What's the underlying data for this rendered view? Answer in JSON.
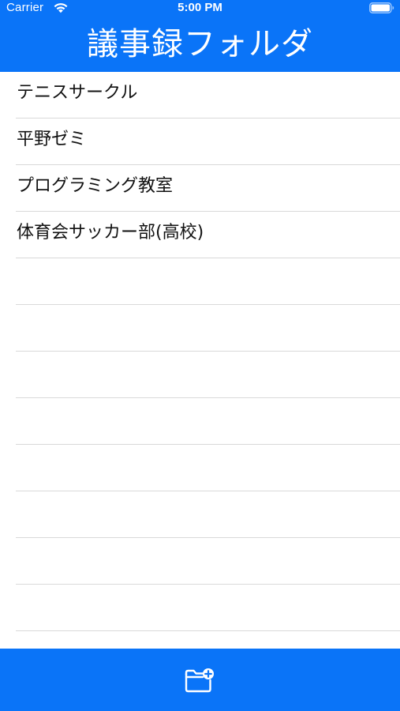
{
  "status_bar": {
    "carrier": "Carrier",
    "time": "5:00 PM",
    "icons": [
      "wifi-icon",
      "battery-icon"
    ]
  },
  "nav": {
    "title": "議事録フォルダ"
  },
  "folders": [
    {
      "label": "テニスサークル"
    },
    {
      "label": "平野ゼミ"
    },
    {
      "label": "プログラミング教室"
    },
    {
      "label": "体育会サッカー部(高校)"
    }
  ],
  "empty_row_count_visible": 8,
  "toolbar": {
    "add_folder_icon": "folder-plus-icon"
  },
  "colors": {
    "accent": "#0a74f8",
    "separator": "#d9d9d9",
    "text": "#111111"
  }
}
